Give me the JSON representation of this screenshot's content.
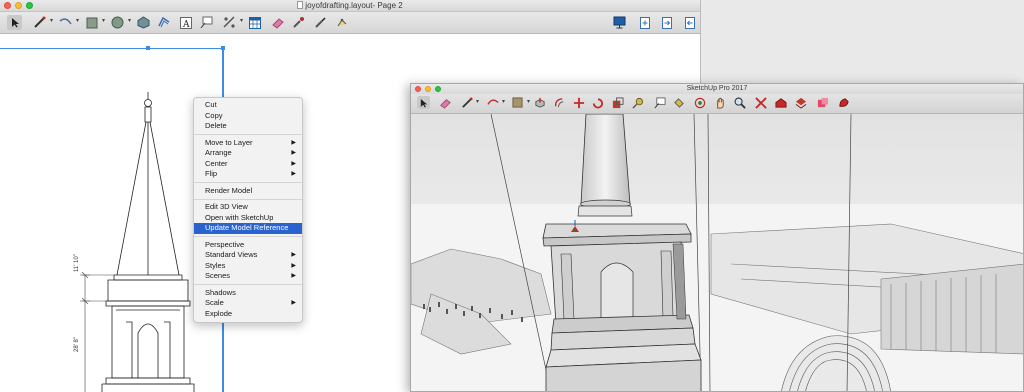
{
  "layout_window": {
    "title": "joyofdrafting.layout- Page 2",
    "toolbar_icons": [
      "select-arrow",
      "line-pen",
      "arc",
      "rectangle",
      "circle",
      "polygon",
      "offset",
      "text",
      "label",
      "dimension",
      "table",
      "eraser",
      "style-dropper",
      "split",
      "join",
      "presentation",
      "add-page",
      "next-page",
      "previous-page"
    ]
  },
  "drawing": {
    "dim_upper": "11' 10\"",
    "dim_lower": "28' 8\""
  },
  "context_menu": {
    "groups": [
      [
        {
          "label": "Cut"
        },
        {
          "label": "Copy"
        },
        {
          "label": "Delete"
        }
      ],
      [
        {
          "label": "Move to Layer",
          "submenu": "▶"
        },
        {
          "label": "Arrange",
          "submenu": "▶"
        },
        {
          "label": "Center",
          "submenu": "▶"
        },
        {
          "label": "Flip",
          "submenu": "▶"
        }
      ],
      [
        {
          "label": "Render Model"
        }
      ],
      [
        {
          "label": "Edit 3D View"
        },
        {
          "label": "Open with SketchUp"
        },
        {
          "label": "Update Model Reference"
        }
      ],
      [
        {
          "label": "Perspective"
        },
        {
          "label": "Standard Views",
          "submenu": "▶"
        },
        {
          "label": "Styles",
          "submenu": "▶"
        },
        {
          "label": "Scenes",
          "submenu": "▶"
        }
      ],
      [
        {
          "label": "Shadows"
        },
        {
          "label": "Scale",
          "submenu": "▶"
        },
        {
          "label": "Explode"
        }
      ]
    ],
    "selected": "Update Model Reference"
  },
  "sketchup_window": {
    "title": "SketchUp Pro 2017"
  },
  "colors": {
    "selection_blue": "#2a63d0",
    "page_edge_blue": "#3d8be4"
  }
}
